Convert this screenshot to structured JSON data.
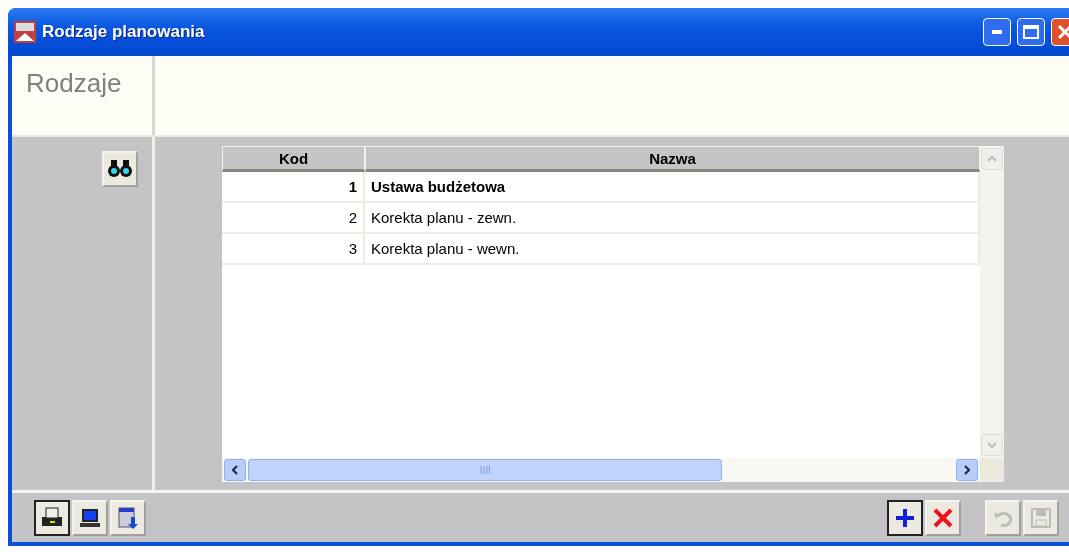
{
  "window": {
    "title": "Rodzaje planowania"
  },
  "header": {
    "title": "Rodzaje"
  },
  "table": {
    "columns": [
      "Kod",
      "Nazwa"
    ],
    "rows": [
      {
        "kod": "1",
        "nazwa": "Ustawa budżetowa",
        "selected": true
      },
      {
        "kod": "2",
        "nazwa": "Korekta planu - zewn.",
        "selected": false
      },
      {
        "kod": "3",
        "nazwa": "Korekta planu - wewn.",
        "selected": false
      }
    ]
  },
  "footer": {
    "left_buttons": [
      {
        "kind": "print",
        "disabled": false
      },
      {
        "kind": "screen",
        "disabled": false
      },
      {
        "kind": "export",
        "disabled": false
      }
    ],
    "right_buttons": [
      {
        "kind": "add",
        "disabled": false
      },
      {
        "kind": "delete",
        "disabled": false
      },
      {
        "kind": "undo",
        "disabled": true
      },
      {
        "kind": "save",
        "disabled": true
      }
    ]
  }
}
